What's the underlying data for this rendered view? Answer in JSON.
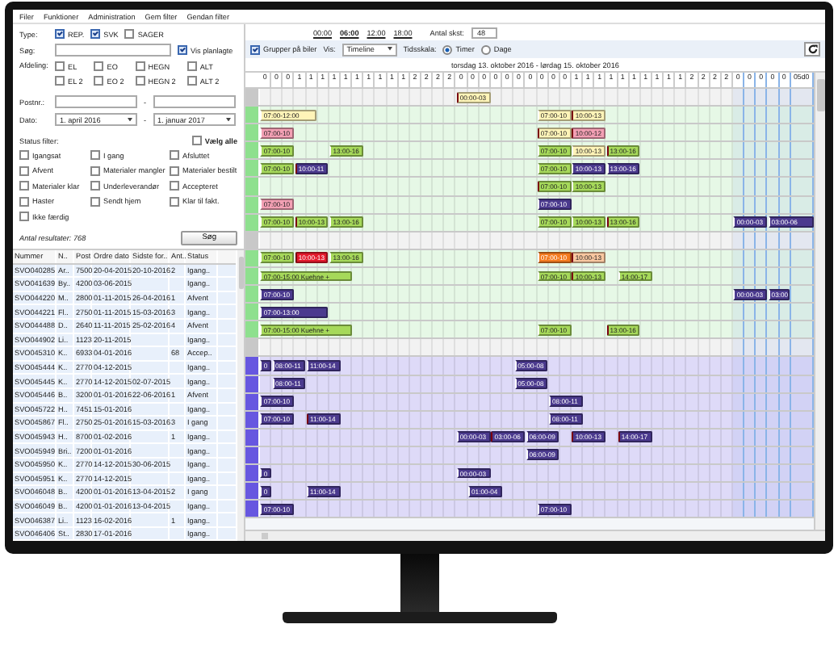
{
  "menu": [
    "Filer",
    "Funktioner",
    "Administration",
    "Gem filter",
    "Gendan filter"
  ],
  "filters": {
    "type_label": "Type:",
    "types": [
      {
        "label": "REP.",
        "checked": true
      },
      {
        "label": "SVK",
        "checked": true
      },
      {
        "label": "SAGER",
        "checked": false
      }
    ],
    "search_label": "Søg:",
    "show_planned": {
      "label": "Vis planlagte",
      "checked": true
    },
    "department_label": "Afdeling:",
    "departments": [
      {
        "label": "EL",
        "checked": false
      },
      {
        "label": "EO",
        "checked": false
      },
      {
        "label": "HEGN",
        "checked": false
      },
      {
        "label": "ALT",
        "checked": false
      },
      {
        "label": "EL 2",
        "checked": false
      },
      {
        "label": "EO 2",
        "checked": false
      },
      {
        "label": "HEGN 2",
        "checked": false
      },
      {
        "label": "ALT 2",
        "checked": false
      }
    ],
    "postcode_label": "Postnr.:",
    "postcode_separator": "-",
    "date_label": "Dato:",
    "date_from": "1. april 2016",
    "date_separator": "-",
    "date_to": "1. januar 2017",
    "status_label": "Status filter:",
    "select_all": {
      "label": "Vælg alle",
      "checked": false
    },
    "statuses": [
      {
        "label": "Igangsat",
        "checked": false
      },
      {
        "label": "I gang",
        "checked": false
      },
      {
        "label": "Afsluttet",
        "checked": false
      },
      {
        "label": "Afvent",
        "checked": false
      },
      {
        "label": "Materialer mangler",
        "checked": false
      },
      {
        "label": "Materialer bestilt",
        "checked": false
      },
      {
        "label": "Materialer klar",
        "checked": false
      },
      {
        "label": "Underleverandør",
        "checked": false
      },
      {
        "label": "Accepteret",
        "checked": false
      },
      {
        "label": "Haster",
        "checked": false
      },
      {
        "label": "Sendt hjem",
        "checked": false
      },
      {
        "label": "Klar til fakt.",
        "checked": false
      },
      {
        "label": "Ikke færdig",
        "checked": false
      }
    ],
    "result_label": "Antal resultater:",
    "result_count": "768",
    "search_button": "Søg"
  },
  "table": {
    "columns": [
      "Nummer",
      "N..",
      "Post",
      "Ordre dato",
      "Sidste for..",
      "Ant..",
      "Status"
    ],
    "rows": [
      [
        "SVO040285",
        "Ar..",
        "7500",
        "20-04-2015",
        "20-10-2016",
        "2",
        "Igang.."
      ],
      [
        "SVO041639",
        "By..",
        "4200",
        "03-06-2015",
        "",
        "",
        "Igang.."
      ],
      [
        "SVO044220",
        "M..",
        "2800",
        "01-11-2015",
        "26-04-2016",
        "1",
        "Afvent"
      ],
      [
        "SVO044221",
        "Fl..",
        "2750",
        "01-11-2015",
        "15-03-2016",
        "3",
        "Igang.."
      ],
      [
        "SVO044488",
        "D..",
        "2640",
        "11-11-2015",
        "25-02-2016",
        "4",
        "Afvent"
      ],
      [
        "SVO044902",
        "Li..",
        "1123",
        "20-11-2015",
        "",
        "",
        "Igang.."
      ],
      [
        "SVO045310",
        "K..",
        "6933",
        "04-01-2016",
        "",
        "68",
        "Accep.."
      ],
      [
        "SVO045444",
        "K..",
        "2770",
        "04-12-2015",
        "",
        "",
        "Igang.."
      ],
      [
        "SVO045445",
        "K..",
        "2770",
        "14-12-2015",
        "02-07-2015",
        "",
        "Igang.."
      ],
      [
        "SVO045446",
        "B..",
        "3200",
        "01-01-2016",
        "22-06-2016",
        "1",
        "Afvent"
      ],
      [
        "SVO045722",
        "H..",
        "7451",
        "15-01-2016",
        "",
        "",
        "Igang.."
      ],
      [
        "SVO045867",
        "Fl..",
        "2750",
        "25-01-2016",
        "15-03-2016",
        "3",
        "I gang"
      ],
      [
        "SVO045943",
        "H..",
        "8700",
        "01-02-2016",
        "",
        "1",
        "Igang.."
      ],
      [
        "SVO045949",
        "Bri..",
        "7200",
        "01-01-2016",
        "",
        "",
        "Igang.."
      ],
      [
        "SVO045950",
        "K..",
        "2770",
        "14-12-2015",
        "30-06-2015",
        "",
        "Igang.."
      ],
      [
        "SVO045951",
        "K..",
        "2770",
        "14-12-2015",
        "",
        "",
        "Igang.."
      ],
      [
        "SVO046048",
        "B..",
        "4200",
        "01-01-2016",
        "13-04-2015",
        "2",
        "I gang"
      ],
      [
        "SVO046049",
        "B..",
        "4200",
        "01-01-2016",
        "13-04-2015",
        "",
        "Igang.."
      ],
      [
        "SVO046387",
        "Li..",
        "1123",
        "16-02-2016",
        "",
        "1",
        "Igang.."
      ],
      [
        "SVO046406",
        "St..",
        "2830",
        "17-01-2016",
        "",
        "",
        "Igang.."
      ]
    ]
  },
  "toolbar": {
    "times": [
      {
        "label": "00:00",
        "selected": false
      },
      {
        "label": "06:00",
        "selected": true
      },
      {
        "label": "12:00",
        "selected": false
      },
      {
        "label": "18:00",
        "selected": false
      }
    ],
    "count_label": "Antal skst:",
    "count_value": "48",
    "group": {
      "label": "Grupper på biler",
      "checked": true
    },
    "view_label": "Vis:",
    "view_value": "Timeline",
    "scale_label": "Tidsskala:",
    "scales": [
      {
        "label": "Timer",
        "selected": true
      },
      {
        "label": "Dage",
        "selected": false
      }
    ]
  },
  "timeline": {
    "range": "torsdag 13. oktober 2016 - lørdag 15. oktober 2016",
    "hours": [
      "0",
      "0",
      "0",
      "1",
      "1",
      "1",
      "1",
      "1",
      "1",
      "1",
      "1",
      "1",
      "1",
      "2",
      "2",
      "2",
      "2",
      "0",
      "0",
      "0",
      "0",
      "0",
      "0",
      "0",
      "0",
      "0",
      "0",
      "1",
      "1",
      "1",
      "1",
      "1",
      "1",
      "1",
      "1",
      "1",
      "1",
      "2",
      "2",
      "2",
      "2",
      "0",
      "0",
      "0",
      "0",
      "0",
      "05d0"
    ],
    "rows": [
      {
        "kind": "gap",
        "color": "#c8c8c8",
        "events": [
          {
            "label": "00:00-03",
            "color": "#fff4b8",
            "flag": true
          }
        ]
      },
      {
        "kind": "lane",
        "color": "#8ee08e",
        "events": [
          {
            "label": "07:00-12:00",
            "color": "#fff4b8",
            "flag": false
          },
          {
            "label": "07:00-10",
            "color": "#fff4b8",
            "flag": false
          },
          {
            "label": "10:00-13",
            "color": "#fff4b8",
            "flag": true
          }
        ]
      },
      {
        "kind": "lane",
        "color": "#8ee08e",
        "events": [
          {
            "label": "07:00-10",
            "color": "#f3a0b4",
            "flag": false
          },
          {
            "label": "07:00-10",
            "color": "#fff4b8",
            "flag": true
          },
          {
            "label": "10:00-12",
            "color": "#f3a0b4",
            "flag": true
          }
        ]
      },
      {
        "kind": "lane",
        "color": "#8ee08e",
        "events": [
          {
            "label": "07:00-10",
            "color": "#a6d95a",
            "flag": false
          },
          {
            "label": "13:00-16",
            "color": "#a6d95a",
            "flag": false
          },
          {
            "label": "07:00-10",
            "color": "#a6d95a",
            "flag": false
          },
          {
            "label": "10:00-13",
            "color": "#fff4b8",
            "flag": false
          },
          {
            "label": "13:00-16",
            "color": "#a6d95a",
            "flag": true
          }
        ]
      },
      {
        "kind": "lane",
        "color": "#8ee08e",
        "events": [
          {
            "label": "07:00-10",
            "color": "#a6d95a",
            "flag": false
          },
          {
            "label": "10:00-11",
            "color": "#4b3a8e",
            "flag": true
          },
          {
            "label": "07:00-10",
            "color": "#a6d95a",
            "flag": false
          },
          {
            "label": "10:00-13",
            "color": "#4b3a8e",
            "flag": false
          },
          {
            "label": "13:00-16",
            "color": "#4b3a8e",
            "flag": false
          }
        ]
      },
      {
        "kind": "lane",
        "color": "#8ee08e",
        "events": [
          {
            "label": "07:00-10",
            "color": "#a6d95a",
            "flag": true
          },
          {
            "label": "10:00-13",
            "color": "#a6d95a",
            "flag": false
          }
        ]
      },
      {
        "kind": "lane",
        "color": "#8ee08e",
        "events": [
          {
            "label": "07:00-10",
            "color": "#f3a0b4",
            "flag": false
          },
          {
            "label": "07:00-10",
            "color": "#4b3a8e",
            "flag": false
          }
        ]
      },
      {
        "kind": "lane",
        "color": "#8ee08e",
        "events": [
          {
            "label": "07:00-10",
            "color": "#a6d95a",
            "flag": false
          },
          {
            "label": "10:00-13",
            "color": "#a6d95a",
            "flag": true
          },
          {
            "label": "13:00-16",
            "color": "#a6d95a",
            "flag": false
          },
          {
            "label": "07:00-10",
            "color": "#a6d95a",
            "flag": false
          },
          {
            "label": "10:00-13",
            "color": "#a6d95a",
            "flag": false
          },
          {
            "label": "13:00-16",
            "color": "#a6d95a",
            "flag": true
          },
          {
            "label": "00:00-03",
            "color": "#4b3a8e",
            "flag": false
          },
          {
            "label": "03:00-06",
            "color": "#4b3a8e",
            "flag": false
          }
        ]
      },
      {
        "kind": "gap",
        "color": "#c8c8c8",
        "events": []
      },
      {
        "kind": "lane",
        "color": "#8ee08e",
        "events": [
          {
            "label": "07:00-10",
            "color": "#a6d95a",
            "flag": false
          },
          {
            "label": "10:00-13",
            "color": "#e3192b",
            "flag": true
          },
          {
            "label": "13:00-16",
            "color": "#a6d95a",
            "flag": false
          },
          {
            "label": "07:00-10",
            "color": "#f47b20",
            "flag": false
          },
          {
            "label": "10:00-13",
            "color": "#f9c7a0",
            "flag": true
          }
        ]
      },
      {
        "kind": "lane",
        "color": "#8ee08e",
        "events": [
          {
            "label": "07:00-15:00  Kuehne +",
            "color": "#a6d95a",
            "flag": false
          },
          {
            "label": "07:00-10",
            "color": "#a6d95a",
            "flag": false
          },
          {
            "label": "10:00-13",
            "color": "#a6d95a",
            "flag": true
          },
          {
            "label": "14:00-17",
            "color": "#a6d95a",
            "flag": false
          }
        ]
      },
      {
        "kind": "lane",
        "color": "#8ee08e",
        "events": [
          {
            "label": "07:00-10",
            "color": "#4b3a8e",
            "flag": false
          },
          {
            "label": "00:00-03",
            "color": "#4b3a8e",
            "flag": false
          },
          {
            "label": "03:00",
            "color": "#4b3a8e",
            "flag": false
          }
        ]
      },
      {
        "kind": "lane",
        "color": "#8ee08e",
        "events": [
          {
            "label": "07:00-13:00",
            "color": "#4b3a8e",
            "flag": false
          }
        ]
      },
      {
        "kind": "lane",
        "color": "#8ee08e",
        "events": [
          {
            "label": "07:00-15:00  Kuehne +",
            "color": "#a6d95a",
            "flag": false
          },
          {
            "label": "07:00-10",
            "color": "#a6d95a",
            "flag": false
          },
          {
            "label": "13:00-16",
            "color": "#a6d95a",
            "flag": true
          }
        ]
      },
      {
        "kind": "gap",
        "color": "#c8c8c8",
        "events": []
      },
      {
        "kind": "lane",
        "color": "#6757e0",
        "events": [
          {
            "label": "0",
            "color": "#4b3a8e",
            "flag": false
          },
          {
            "label": "08:00-11",
            "color": "#4b3a8e",
            "flag": false
          },
          {
            "label": "11:00-14",
            "color": "#4b3a8e",
            "flag": false
          },
          {
            "label": "05:00-08",
            "color": "#4b3a8e",
            "flag": false
          }
        ]
      },
      {
        "kind": "lane",
        "color": "#6757e0",
        "events": [
          {
            "label": "08:00-11",
            "color": "#4b3a8e",
            "flag": false
          },
          {
            "label": "05:00-08",
            "color": "#4b3a8e",
            "flag": false
          }
        ]
      },
      {
        "kind": "lane",
        "color": "#6757e0",
        "events": [
          {
            "label": "07:00-10",
            "color": "#4b3a8e",
            "flag": false
          },
          {
            "label": "08:00-11",
            "color": "#4b3a8e",
            "flag": false
          }
        ]
      },
      {
        "kind": "lane",
        "color": "#6757e0",
        "events": [
          {
            "label": "07:00-10",
            "color": "#4b3a8e",
            "flag": false
          },
          {
            "label": "11:00-14",
            "color": "#4b3a8e",
            "flag": true
          },
          {
            "label": "08:00-11",
            "color": "#4b3a8e",
            "flag": false
          }
        ]
      },
      {
        "kind": "lane",
        "color": "#6757e0",
        "events": [
          {
            "label": "00:00-03",
            "color": "#4b3a8e",
            "flag": false
          },
          {
            "label": "03:00-06",
            "color": "#4b3a8e",
            "flag": true
          },
          {
            "label": "06:00-09",
            "color": "#4b3a8e",
            "flag": false
          },
          {
            "label": "10:00-13",
            "color": "#4b3a8e",
            "flag": true
          },
          {
            "label": "14:00-17",
            "color": "#4b3a8e",
            "flag": true
          }
        ]
      },
      {
        "kind": "lane",
        "color": "#6757e0",
        "events": [
          {
            "label": "06:00-09",
            "color": "#4b3a8e",
            "flag": false
          }
        ]
      },
      {
        "kind": "lane",
        "color": "#6757e0",
        "events": [
          {
            "label": "0",
            "color": "#4b3a8e",
            "flag": false
          },
          {
            "label": "00:00-03",
            "color": "#4b3a8e",
            "flag": false
          }
        ]
      },
      {
        "kind": "lane",
        "color": "#6757e0",
        "events": [
          {
            "label": "0",
            "color": "#4b3a8e",
            "flag": false
          },
          {
            "label": "11:00-14",
            "color": "#4b3a8e",
            "flag": false
          },
          {
            "label": "01:00-04",
            "color": "#4b3a8e",
            "flag": false
          }
        ]
      },
      {
        "kind": "lane",
        "color": "#6757e0",
        "events": [
          {
            "label": "07:00-10",
            "color": "#4b3a8e",
            "flag": false
          },
          {
            "label": "07:00-10",
            "color": "#4b3a8e",
            "flag": false
          }
        ]
      }
    ]
  }
}
